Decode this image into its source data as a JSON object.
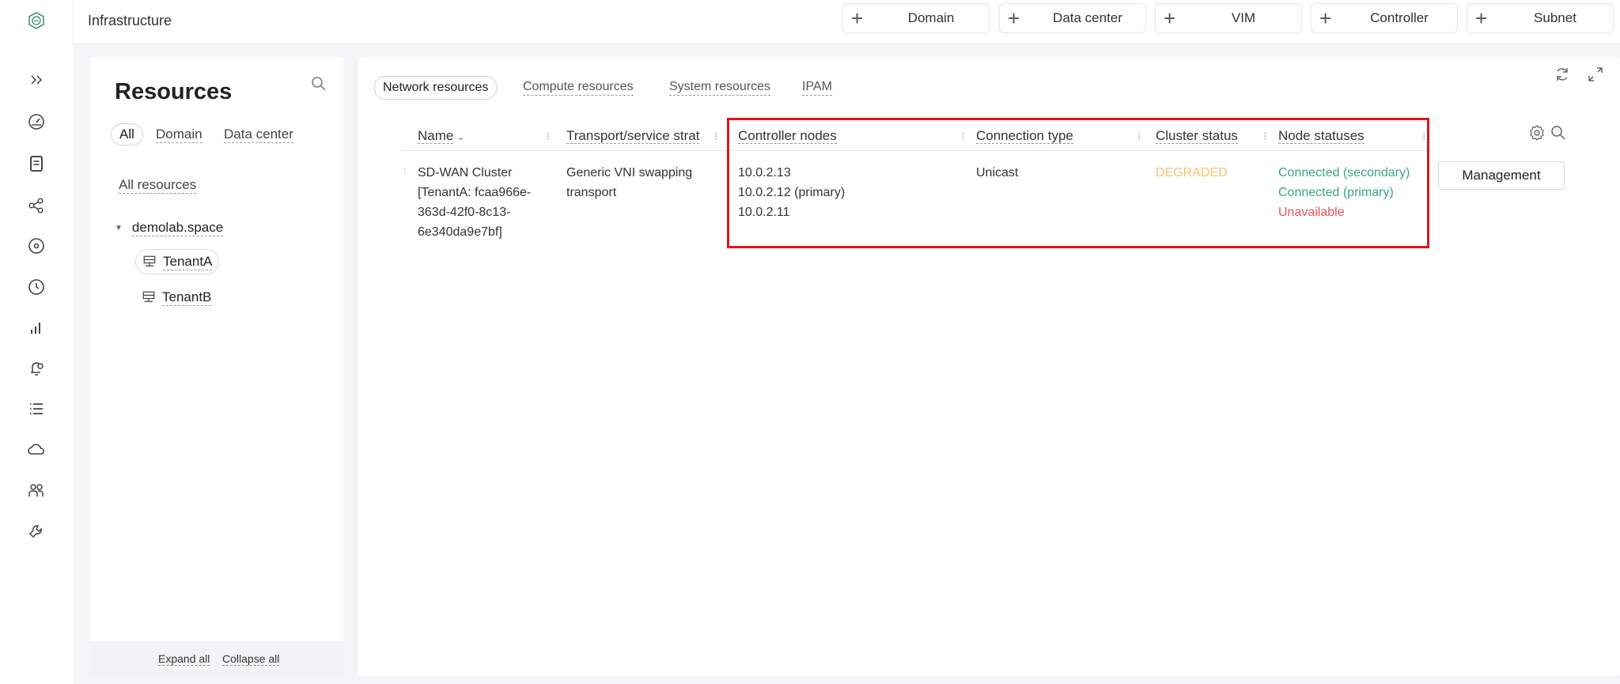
{
  "topbar": {
    "title": "Infrastructure",
    "add_buttons": [
      {
        "label": "Domain"
      },
      {
        "label": "Data center"
      },
      {
        "label": "VIM"
      },
      {
        "label": "Controller"
      },
      {
        "label": "Subnet"
      }
    ]
  },
  "rail": {
    "icons": [
      "logo-icon",
      "expand-icon",
      "dashboard-icon",
      "document-icon",
      "share-icon",
      "location-icon",
      "clock-icon",
      "chart-icon",
      "alert-icon",
      "list-icon",
      "cloud-icon",
      "users-icon",
      "tools-icon"
    ]
  },
  "resources": {
    "title": "Resources",
    "filters": [
      "All",
      "Domain",
      "Data center"
    ],
    "all_resources": "All resources",
    "tree_root": "demolab.space",
    "tenants": [
      "TenantA",
      "TenantB"
    ],
    "expand_all": "Expand all",
    "collapse_all": "Collapse all"
  },
  "main": {
    "tabs": [
      "Network resources",
      "Compute resources",
      "System resources",
      "IPAM"
    ],
    "columns": [
      "Name",
      "Transport/service strat",
      "Controller nodes",
      "Connection type",
      "Cluster status",
      "Node statuses"
    ],
    "row": {
      "name": [
        "SD-WAN Cluster",
        "[TenantA: fcaa966e-",
        "363d-42f0-8c13-",
        "6e340da9e7bf]"
      ],
      "transport": [
        "Generic VNI swapping",
        "transport"
      ],
      "controller_nodes": [
        "10.0.2.13",
        "10.0.2.12 (primary)",
        "10.0.2.11"
      ],
      "connection_type": "Unicast",
      "cluster_status": "DEGRADED",
      "node_statuses": [
        "Connected (secondary)",
        "Connected (primary)",
        "Unavailable"
      ],
      "action": "Management"
    }
  },
  "colors": {
    "degraded": "#f5c36b",
    "connected": "#3aa57f",
    "unavailable": "#e8525a",
    "highlight": "#e0141b"
  }
}
